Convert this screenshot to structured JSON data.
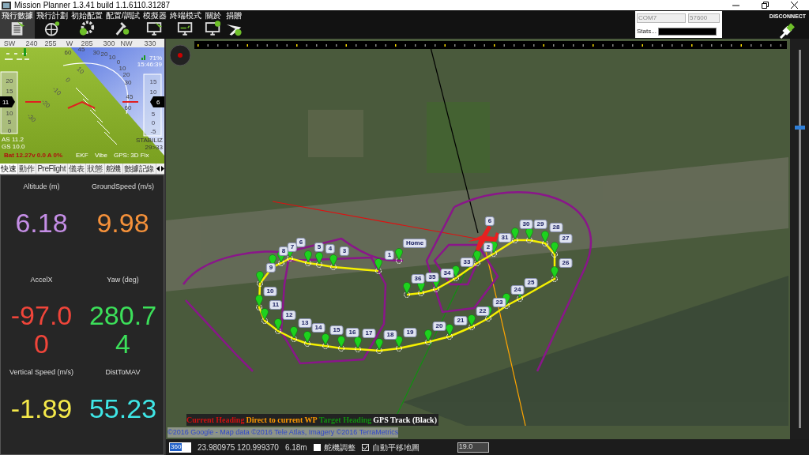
{
  "window": {
    "title": "Mission Planner 1.3.41 build 1.1.6110.31287"
  },
  "menu": [
    {
      "label": "飛行數據",
      "selected": true
    },
    {
      "label": "飛行計劃",
      "selected": false
    },
    {
      "label": "初始配置",
      "selected": false
    },
    {
      "label": "配置/調試",
      "selected": false
    },
    {
      "label": "模擬器",
      "selected": false
    },
    {
      "label": "終端模式",
      "selected": false
    },
    {
      "label": "關於",
      "selected": false
    },
    {
      "label": "捐贈",
      "selected": false
    }
  ],
  "connection": {
    "port": "COM7",
    "baud": "57600",
    "stats_label": "Stats...",
    "connect_label": "DISCONNECT"
  },
  "hud": {
    "heading_tape": [
      "SW",
      "240",
      "255",
      "W",
      "285",
      "300",
      "NW",
      "330"
    ],
    "battery_remaining": "71%",
    "time": "15:46:39",
    "roll_scale": [
      "60",
      "45",
      "30",
      "20",
      "10",
      "0",
      "10",
      "20",
      "30",
      "45",
      "60"
    ],
    "pitch_ladder": [
      "10",
      "0",
      "-10",
      "-20",
      "-30"
    ],
    "speed_ticks": [
      "20",
      "15",
      "10",
      "5",
      "0"
    ],
    "speed": "11",
    "alt_ticks": [
      "15",
      "10",
      "5",
      "0",
      "-5"
    ],
    "altitude": "6",
    "airspeed": "AS 11.2",
    "groundspeed": "GS 10.0",
    "mode": "STABILIZ",
    "wp_info": "29>33",
    "battery": "Bat 12.27v 0.0 A 0%",
    "ekf": "EKF",
    "vibe": "Vibe",
    "gps": "GPS: 3D Fix"
  },
  "tabs": [
    {
      "label": "快速",
      "selected": true
    },
    {
      "label": "動作",
      "selected": false
    },
    {
      "label": "PreFlight",
      "selected": false
    },
    {
      "label": "儀表",
      "selected": false
    },
    {
      "label": "狀態",
      "selected": false
    },
    {
      "label": "舵機",
      "selected": false
    },
    {
      "label": "數據記錄",
      "selected": false
    }
  ],
  "quick": [
    {
      "label": "Altitude (m)",
      "value": "6.18",
      "color": "#c58ee6"
    },
    {
      "label": "GroundSpeed (m/s)",
      "value": "9.98",
      "color": "#f5913a"
    },
    {
      "label": "AccelX",
      "value": "-97.00",
      "color": "#f0453a"
    },
    {
      "label": "Yaw (deg)",
      "value": "280.74",
      "color": "#3ce05a"
    },
    {
      "label": "Vertical Speed (m/s)",
      "value": "-1.89",
      "color": "#f5e94a"
    },
    {
      "label": "DistToMAV",
      "value": "55.23",
      "color": "#3fe6e6"
    }
  ],
  "map": {
    "waypoints": [
      "Home",
      "1",
      "3",
      "4",
      "5",
      "6",
      "7",
      "8",
      "9",
      "10",
      "11",
      "12",
      "13",
      "14",
      "15",
      "16",
      "17",
      "18",
      "19",
      "20",
      "21",
      "22",
      "23",
      "24",
      "25",
      "26",
      "27",
      "28",
      "29",
      "30",
      "31",
      "2",
      "33",
      "34",
      "35",
      "36"
    ],
    "plane_label": "6",
    "legend": [
      {
        "text": "Current Heading",
        "kind": "heading"
      },
      {
        "text": "Direct to current WP",
        "kind": "direct"
      },
      {
        "text": "Target Heading",
        "kind": "target"
      },
      {
        "text": "GPS Track (Black)",
        "kind": "track"
      }
    ],
    "attribution": "©2016 Google - Map data ©2016 Tele Atlas, Imagery ©2016 TerraMetrics",
    "zoom_slider": {
      "level": 0.8
    }
  },
  "status_bar": {
    "field": "360",
    "position": "23.980975 120.999370",
    "altitude": "6.18m",
    "options": [
      {
        "label": "舵機調整",
        "checked": false
      },
      {
        "label": "自動平移地圖",
        "checked": true
      }
    ],
    "zoom": "19.0"
  }
}
